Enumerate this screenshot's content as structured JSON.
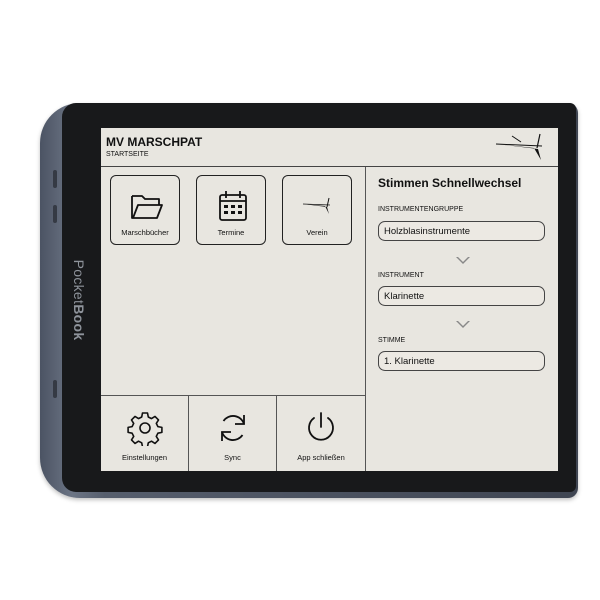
{
  "device": {
    "brand_logo": "PocketBook"
  },
  "header": {
    "title": "MV MARSCHPAT",
    "subtitle": "STARTSEITE"
  },
  "tiles": [
    {
      "label": "Marschbücher",
      "icon": "folder-icon"
    },
    {
      "label": "Termine",
      "icon": "calendar-icon"
    },
    {
      "label": "Verein",
      "icon": "baton-logo-icon"
    }
  ],
  "bottom_bar": [
    {
      "label": "Einstellungen",
      "icon": "gear-icon"
    },
    {
      "label": "Sync",
      "icon": "sync-icon"
    },
    {
      "label": "App schließen",
      "icon": "power-icon"
    }
  ],
  "quick_switch": {
    "title": "Stimmen Schnellwechsel",
    "group_label": "INSTRUMENTENGRUPPE",
    "group_value": "Holzblasinstrumente",
    "instrument_label": "INSTRUMENT",
    "instrument_value": "Klarinette",
    "voice_label": "STIMME",
    "voice_value": "1. Klarinette"
  },
  "colors": {
    "screen": "#e8e6e0",
    "ink": "#111111",
    "bezel": "#18191b",
    "shell": "#565e6d"
  }
}
